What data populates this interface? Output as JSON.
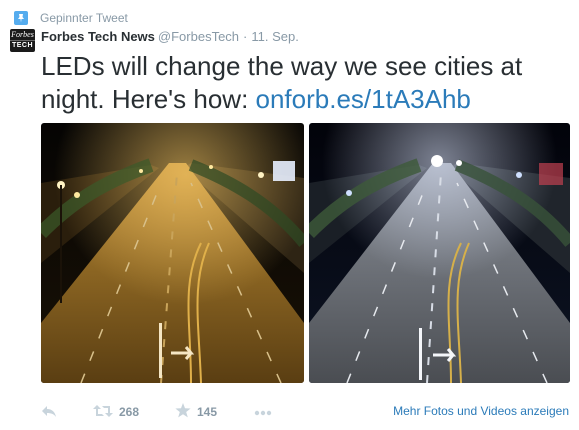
{
  "pinned": {
    "label": "Gepinnter Tweet",
    "icon": "pin-icon"
  },
  "author": {
    "avatar_line1": "Forbes",
    "avatar_line2": "TECH",
    "name": "Forbes Tech News",
    "handle": "@ForbesTech",
    "separator": "·",
    "date": "11. Sep."
  },
  "tweet": {
    "text": "LEDs will change the way we see cities at night. Here's how: ",
    "link": "onforb.es/1tA3Ahb"
  },
  "media": [
    {
      "name": "photo-sodium-street-night"
    },
    {
      "name": "photo-led-street-night"
    }
  ],
  "actions": {
    "reply_icon": "reply-icon",
    "retweet_icon": "retweet-icon",
    "retweet_count": "268",
    "favorite_icon": "star-icon",
    "favorite_count": "145",
    "more_icon": "more-icon",
    "more_media_label": "Mehr Fotos und Videos anzeigen"
  },
  "colors": {
    "accent": "#55acee",
    "link": "#2b7bb9",
    "muted": "#8899a6",
    "text": "#292f33"
  }
}
